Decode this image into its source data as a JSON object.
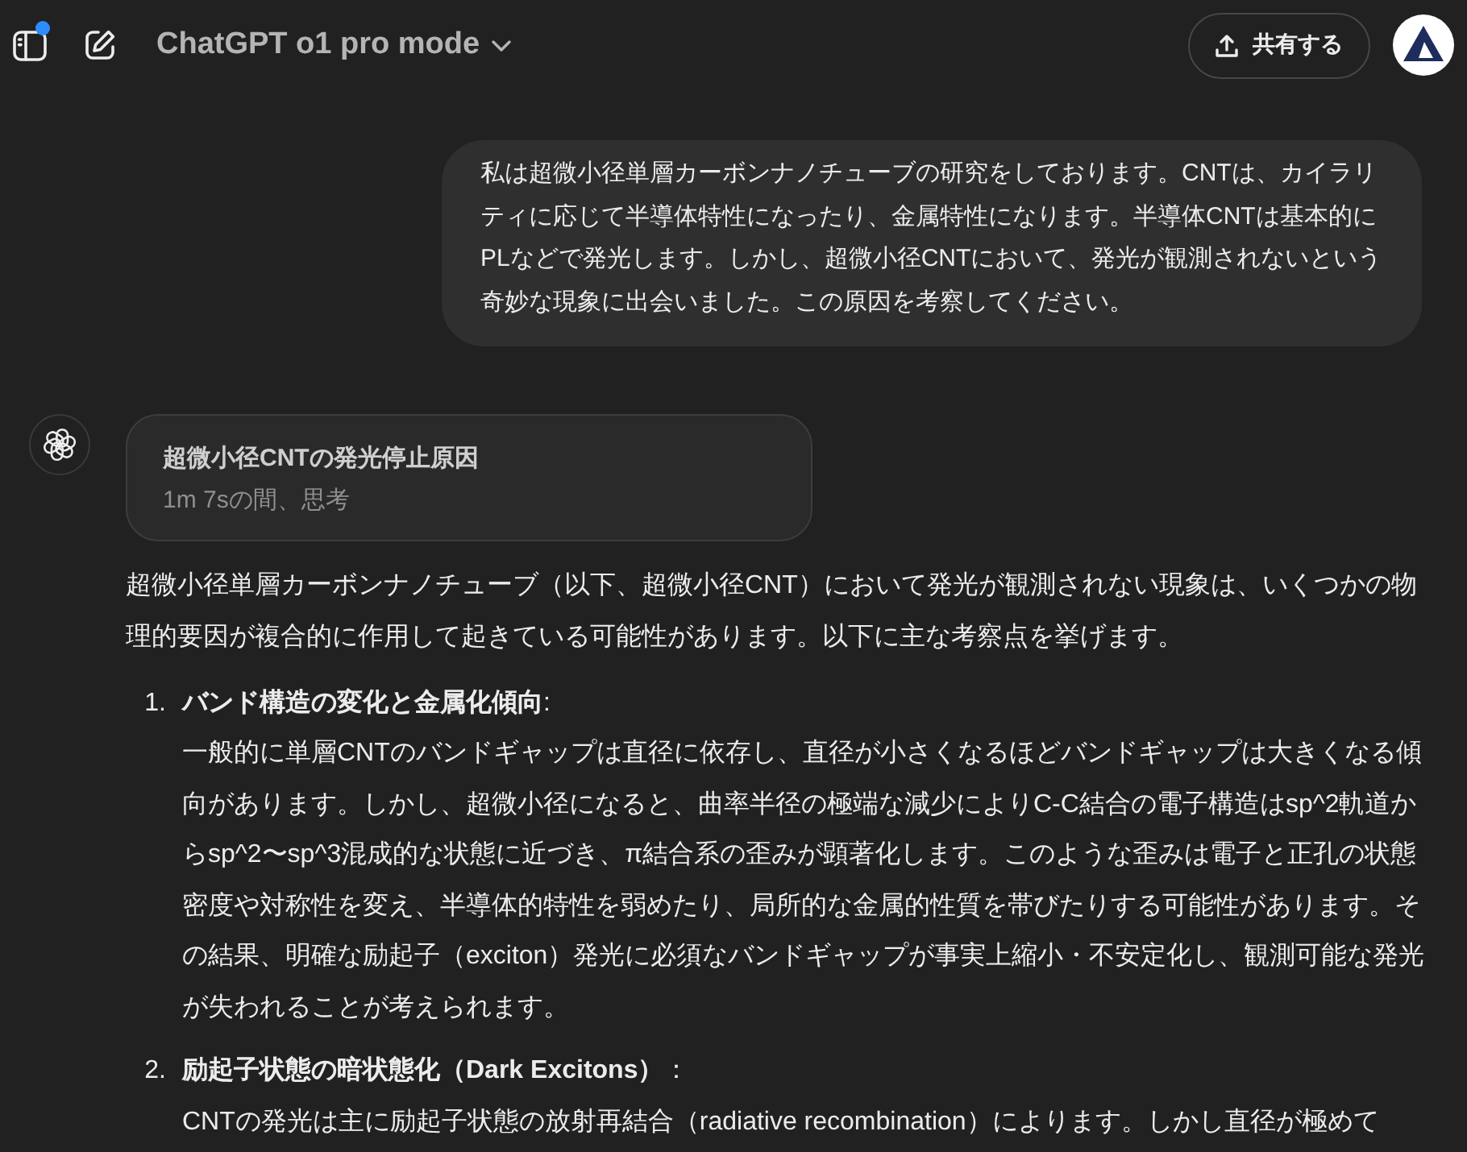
{
  "header": {
    "sidebar_notification": true,
    "model": "ChatGPT o1 pro mode",
    "share": "共有する"
  },
  "messages": [
    {
      "kind": "user",
      "text": "私は超微小径単層カーボンナノチューブの研究をしております。CNTは、カイラリティに応じて半導体特性になったり、金属特性になります。半導体CNTは基本的にPLなどで発光します。しかし、超微小径CNTにおいて、発光が観測されないという奇妙な現象に出会いました。この原因を考察してください。"
    },
    {
      "kind": "assistant",
      "reasoning": {
        "title": "超微小径CNTの発光停止原因",
        "duration": "1m 7sの間、思考"
      },
      "intro": "超微小径単層カーボンナノチューブ（以下、超微小径CNT）において発光が観測されない現象は、いくつかの物理的要因が複合的に作用して起きている可能性があります。以下に主な考察点を挙げます。",
      "points": [
        {
          "number": "1.",
          "title": "**バンド構造の変化と金属化傾向**:",
          "body": "一般的に単層CNTのバンドギャップは直径に依存し、直径が小さくなるほどバンドギャップは大きくなる傾向があります。しかし、超微小径になると、曲率半径の極端な減少によりC-C結合の電子構造はsp^2軌道からsp^2〜sp^3混成的な状態に近づき、π結合系の歪みが顕著化します。このような歪みは電子と正孔の状態密度や対称性を変え、半導体的特性を弱めたり、局所的な金属的性質を帯びたりする可能性があります。その結果、明確な励起子（exciton）発光に必須なバンドギャップが事実上縮小・不安定化し、観測可能な発光が失われることが考えられます。"
        },
        {
          "number": "2.",
          "title": "**励起子状態の暗状態化（Dark Excitons）**：",
          "body": "CNTの発光は主に励起子状態の放射再結合（radiative recombination）によります。しかし直径が極めて"
        }
      ]
    }
  ]
}
